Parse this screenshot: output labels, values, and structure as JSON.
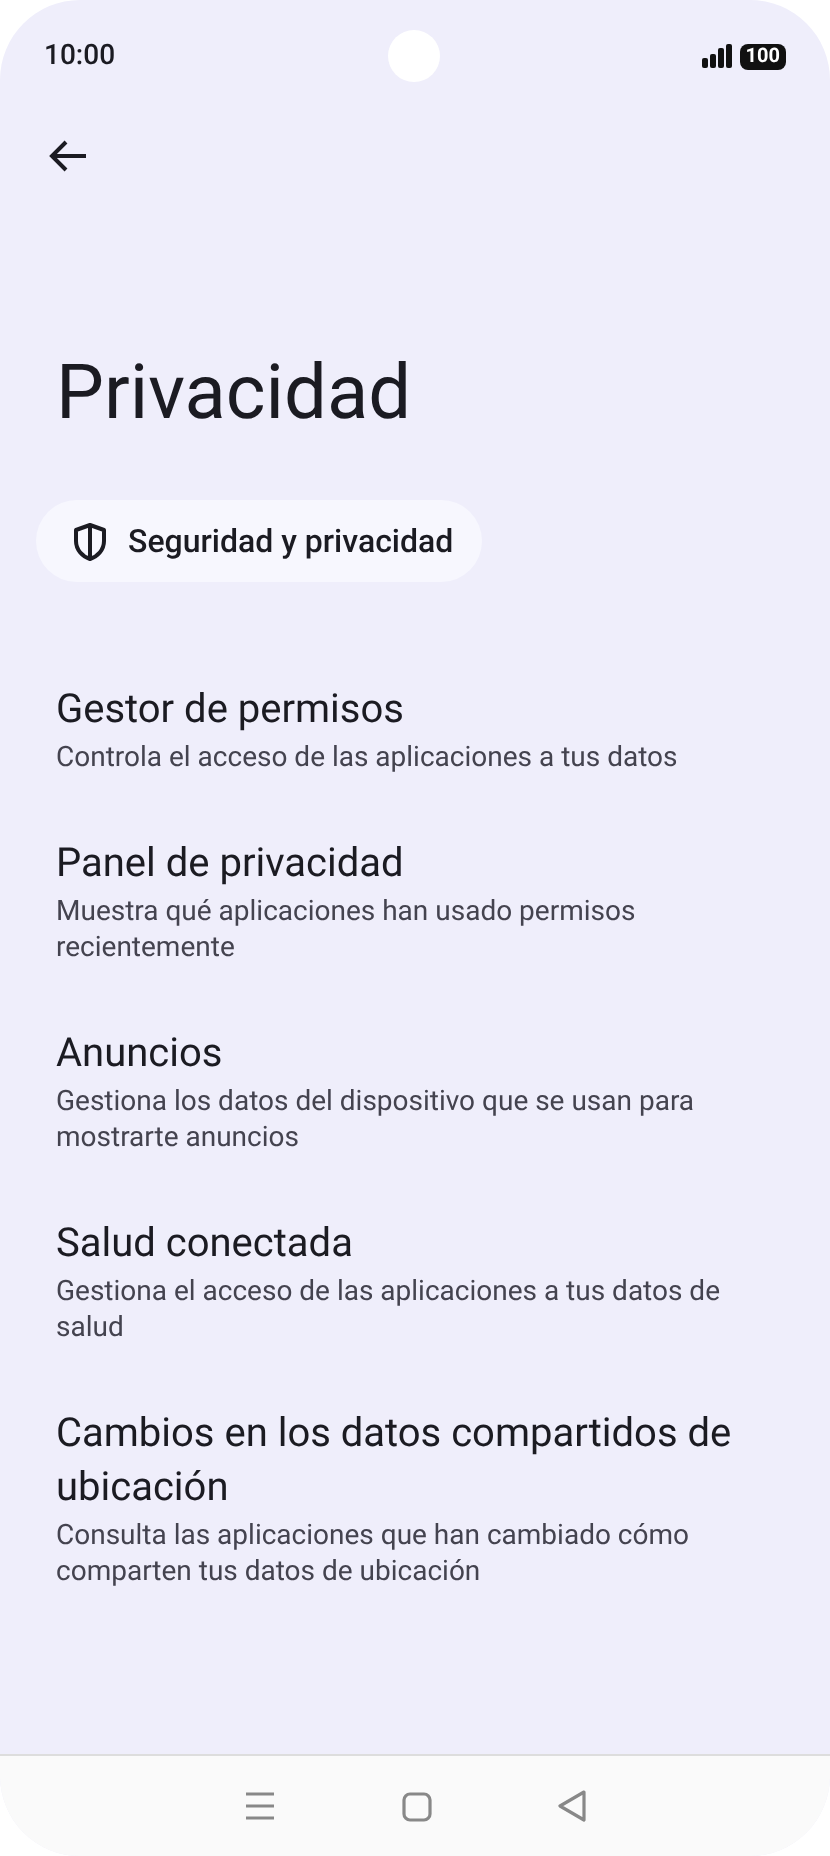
{
  "status_bar": {
    "time": "10:00",
    "battery": "100"
  },
  "title": "Privacidad",
  "chip": {
    "label": "Seguridad y privacidad"
  },
  "items": [
    {
      "title": "Gestor de permisos",
      "subtitle": "Controla el acceso de las aplicaciones a tus datos"
    },
    {
      "title": "Panel de privacidad",
      "subtitle": "Muestra qué aplicaciones han usado permisos recientemente"
    },
    {
      "title": "Anuncios",
      "subtitle": "Gestiona los datos del dispositivo que se usan para mostrarte anuncios"
    },
    {
      "title": "Salud conectada",
      "subtitle": "Gestiona el acceso de las aplicaciones a tus datos de salud"
    },
    {
      "title": "Cambios en los datos compartidos de ubicación",
      "subtitle": "Consulta las aplicaciones que han cambiado cómo comparten tus datos de ubicación"
    }
  ]
}
